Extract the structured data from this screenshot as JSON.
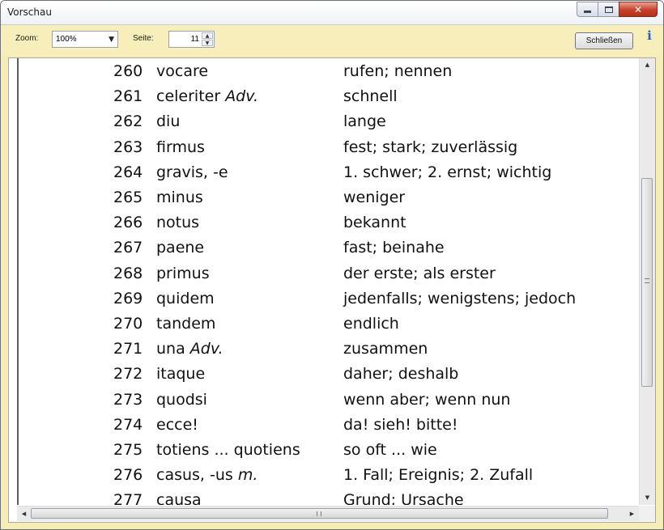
{
  "window": {
    "title": "Vorschau"
  },
  "toolbar": {
    "zoom_label": "Zoom:",
    "zoom_value": "100%",
    "page_label": "Seite:",
    "page_value": "11",
    "close_label": "Schließen",
    "info_icon": "info-icon"
  },
  "vocab": [
    {
      "num": "260",
      "latin": "vocare",
      "latin_suffix": "",
      "german": "rufen; nennen"
    },
    {
      "num": "261",
      "latin": "celeriter ",
      "latin_suffix": "Adv.",
      "german": "schnell"
    },
    {
      "num": "262",
      "latin": "diu",
      "latin_suffix": "",
      "german": "lange"
    },
    {
      "num": "263",
      "latin": "firmus",
      "latin_suffix": "",
      "german": "fest; stark; zuverlässig"
    },
    {
      "num": "264",
      "latin": "gravis, -e",
      "latin_suffix": "",
      "german": "1. schwer; 2. ernst; wichtig"
    },
    {
      "num": "265",
      "latin": "minus",
      "latin_suffix": "",
      "german": "weniger"
    },
    {
      "num": "266",
      "latin": "notus",
      "latin_suffix": "",
      "german": "bekannt"
    },
    {
      "num": "267",
      "latin": "paene",
      "latin_suffix": "",
      "german": "fast; beinahe"
    },
    {
      "num": "268",
      "latin": "primus",
      "latin_suffix": "",
      "german": "der erste; als erster"
    },
    {
      "num": "269",
      "latin": "quidem",
      "latin_suffix": "",
      "german": "jedenfalls; wenigstens; jedoch"
    },
    {
      "num": "270",
      "latin": "tandem",
      "latin_suffix": "",
      "german": "endlich"
    },
    {
      "num": "271",
      "latin": "una ",
      "latin_suffix": "Adv.",
      "german": "zusammen"
    },
    {
      "num": "272",
      "latin": "itaque",
      "latin_suffix": "",
      "german": "daher; deshalb"
    },
    {
      "num": "273",
      "latin": "quodsi",
      "latin_suffix": "",
      "german": "wenn aber; wenn nun"
    },
    {
      "num": "274",
      "latin": "ecce!",
      "latin_suffix": "",
      "german": "da! sieh! bitte!"
    },
    {
      "num": "275",
      "latin": "totiens ... quotiens",
      "latin_suffix": "",
      "german": "so oft ... wie"
    },
    {
      "num": "276",
      "latin": "casus, -us ",
      "latin_suffix": "m.",
      "german": "1. Fall; Ereignis; 2. Zufall"
    },
    {
      "num": "277",
      "latin": "causa",
      "latin_suffix": "",
      "german": "Grund; Ursache"
    }
  ]
}
